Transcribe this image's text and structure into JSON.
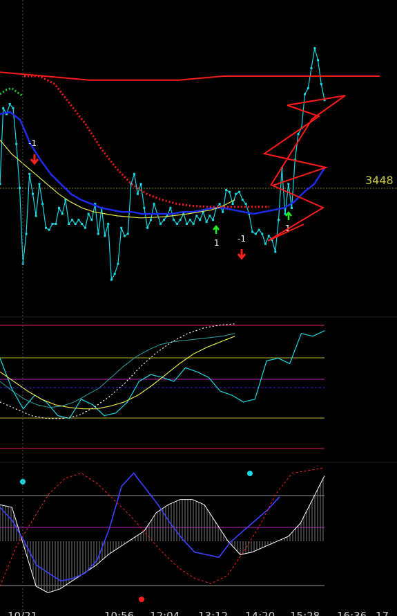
{
  "chart_data": [
    {
      "type": "line",
      "panel": "price",
      "price_label": "3448",
      "ref_level_price": 3448,
      "series": [
        {
          "color": "#19d9e6",
          "values": [
            30,
            68,
            65,
            70,
            68,
            50,
            28,
            -10,
            5,
            35,
            25,
            14,
            30,
            20,
            8,
            7,
            10,
            10,
            18,
            15,
            22,
            10,
            12,
            10,
            12,
            10,
            8,
            15,
            12,
            20,
            5,
            18,
            4,
            10,
            -18,
            -15,
            -10,
            8,
            4,
            5,
            30,
            35,
            25,
            30,
            18,
            8,
            12,
            20,
            15,
            10,
            12,
            14,
            18,
            12,
            10,
            12,
            15,
            10,
            12,
            10,
            14,
            12,
            16,
            11,
            14,
            12,
            18,
            20,
            16,
            27,
            26,
            20,
            25,
            26,
            22,
            20,
            15,
            6,
            5,
            7,
            5,
            0,
            4,
            2,
            -4,
            12,
            38,
            15,
            30,
            18,
            42,
            55,
            58,
            75,
            78,
            88,
            98,
            92,
            80,
            72
          ]
        },
        {
          "color": "#1e2cf0",
          "values": [
            65,
            66,
            62,
            50,
            42,
            35,
            30,
            25,
            22,
            20,
            18,
            17,
            16,
            16,
            15,
            15,
            15,
            15,
            16,
            16,
            17,
            18,
            18,
            17,
            16,
            15,
            16,
            17,
            18,
            21,
            26,
            30,
            38
          ]
        },
        {
          "color": "#ff1a1a",
          "values": [
            86,
            85,
            84,
            83,
            82,
            82,
            82,
            82,
            82,
            83,
            84,
            84,
            84,
            84,
            84,
            84,
            84,
            84
          ]
        },
        {
          "color": "#e8e84a",
          "values": [
            52,
            45,
            40,
            35,
            30,
            25,
            21,
            18,
            16,
            15,
            14,
            13.5,
            13,
            13.2,
            13.6,
            14.3,
            15,
            16,
            17,
            19,
            22
          ]
        },
        {
          "color": "#ff1a1a",
          "values": [
            84,
            84,
            80,
            70,
            60,
            48,
            38,
            30,
            25,
            22,
            20,
            19,
            18.5,
            18.5,
            18.5,
            18.5,
            18.5
          ]
        },
        {
          "color": "#22cc33",
          "values": [
            75,
            77,
            78,
            76,
            74
          ]
        }
      ]
    },
    {
      "type": "line",
      "panel": "oscillator",
      "series": [
        {
          "color": "#19d9e6",
          "values": [
            72,
            50,
            35,
            45,
            40,
            30,
            28,
            42,
            38,
            30,
            32,
            40,
            55,
            60,
            58,
            55,
            65,
            62,
            58,
            48,
            45,
            40,
            42,
            70,
            72,
            68,
            90,
            88,
            92
          ]
        },
        {
          "color": "#2aa6a6",
          "values": [
            55,
            48,
            42,
            38,
            36,
            37,
            40,
            45,
            50,
            58,
            66,
            73,
            78,
            82,
            84,
            85,
            86,
            87,
            88,
            90
          ]
        },
        {
          "color": "#e8e84a",
          "values": [
            62,
            55,
            48,
            42,
            38,
            36,
            35,
            35,
            37,
            40,
            45,
            52,
            60,
            68,
            75,
            80,
            84,
            88
          ]
        },
        {
          "color": "#ffffff",
          "values": [
            40,
            35,
            30,
            28,
            28,
            30,
            36,
            44,
            54,
            66,
            76,
            84,
            90,
            94,
            96,
            97
          ]
        }
      ]
    },
    {
      "type": "line",
      "panel": "cycle",
      "series": [
        {
          "color": "#ffffff",
          "values": [
            72,
            70,
            40,
            10,
            5,
            8,
            14,
            20,
            26,
            34,
            40,
            46,
            52,
            66,
            72,
            76,
            76,
            72,
            58,
            44,
            34,
            36,
            40,
            44,
            48,
            58,
            76,
            94
          ]
        },
        {
          "color": "#4040ff",
          "values": [
            70,
            60,
            44,
            26,
            20,
            14,
            16,
            20,
            30,
            54,
            86,
            96,
            84,
            72,
            58,
            46,
            36,
            34,
            32,
            44,
            52,
            60,
            68,
            78
          ]
        },
        {
          "color": "#ff2020",
          "values": [
            10,
            40,
            60,
            80,
            92,
            96,
            88,
            76,
            64,
            50,
            36,
            24,
            16,
            12,
            18,
            36,
            56,
            80,
            96,
            98,
            100
          ]
        }
      ]
    }
  ],
  "x_ticks": [
    "10/21",
    "10:56",
    "12:04",
    "13:12",
    "14:20",
    "15:28",
    "16:36",
    "17"
  ],
  "annotations": {
    "marker_1_label": "-1",
    "marker_2_label": "1",
    "marker_3_label": "-1",
    "marker_4_label": "1"
  }
}
